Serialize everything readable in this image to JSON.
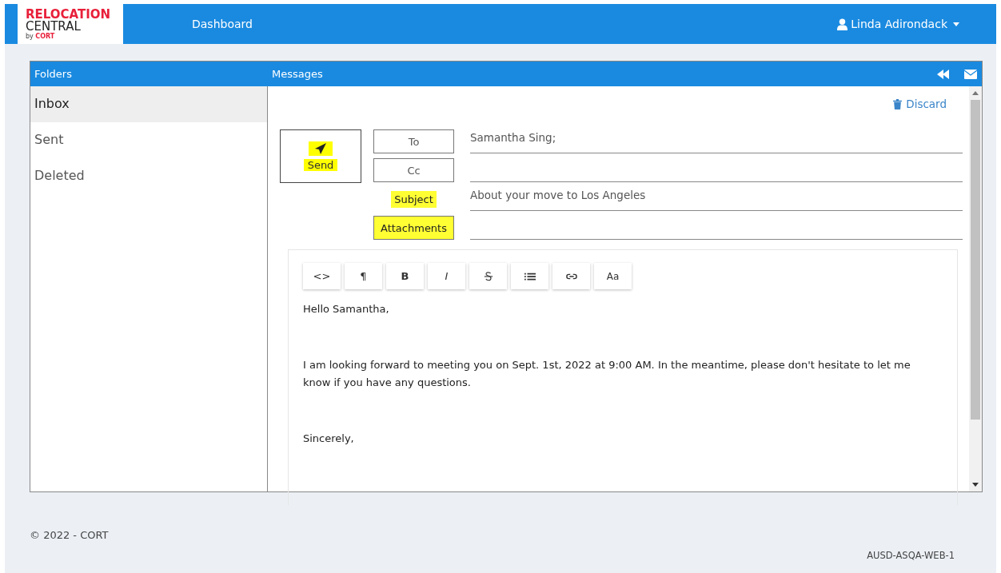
{
  "logo": {
    "line1": "RELOCATION",
    "line2": "CENTRAL",
    "by": "by",
    "brand": "CORT"
  },
  "nav": {
    "link": "Dashboard",
    "user": "Linda Adirondack"
  },
  "folders": {
    "title": "Folders",
    "items": [
      {
        "label": "Inbox",
        "selected": true
      },
      {
        "label": "Sent",
        "selected": false
      },
      {
        "label": "Deleted",
        "selected": false
      }
    ]
  },
  "messages": {
    "title": "Messages",
    "discard": "Discard",
    "send": {
      "label": "Send",
      "highlighted": true
    },
    "fields": [
      {
        "label": "To",
        "boxed": true,
        "highlighted": false,
        "value": "Samantha Sing;"
      },
      {
        "label": "Cc",
        "boxed": true,
        "highlighted": false
      },
      {
        "label": "Subject",
        "boxed": false,
        "highlighted": true,
        "value": "About your move to Los Angeles"
      },
      {
        "label": "Attachments",
        "boxed": true,
        "highlighted": true
      }
    ],
    "toolbar": [
      {
        "kind": "text",
        "label": "<>"
      },
      {
        "kind": "text",
        "label": "¶"
      },
      {
        "kind": "bold",
        "label": "B"
      },
      {
        "kind": "italic",
        "label": "I"
      },
      {
        "kind": "strike"
      },
      {
        "kind": "list"
      },
      {
        "kind": "link"
      },
      {
        "kind": "fontsize",
        "label": "Aa"
      }
    ],
    "body": [
      {
        "text": "Hello Samantha,"
      },
      {
        "text": "I am looking forward to meeting you on Sept. 1st, 2022 at 9:00 AM.  In the meantime, please don't hesitate to let me know if you have any questions."
      },
      {
        "text": "Sincerely,"
      }
    ]
  },
  "footer": {
    "copyright": "© 2022 - CORT",
    "server": "AUSD-ASQA-WEB-1"
  }
}
